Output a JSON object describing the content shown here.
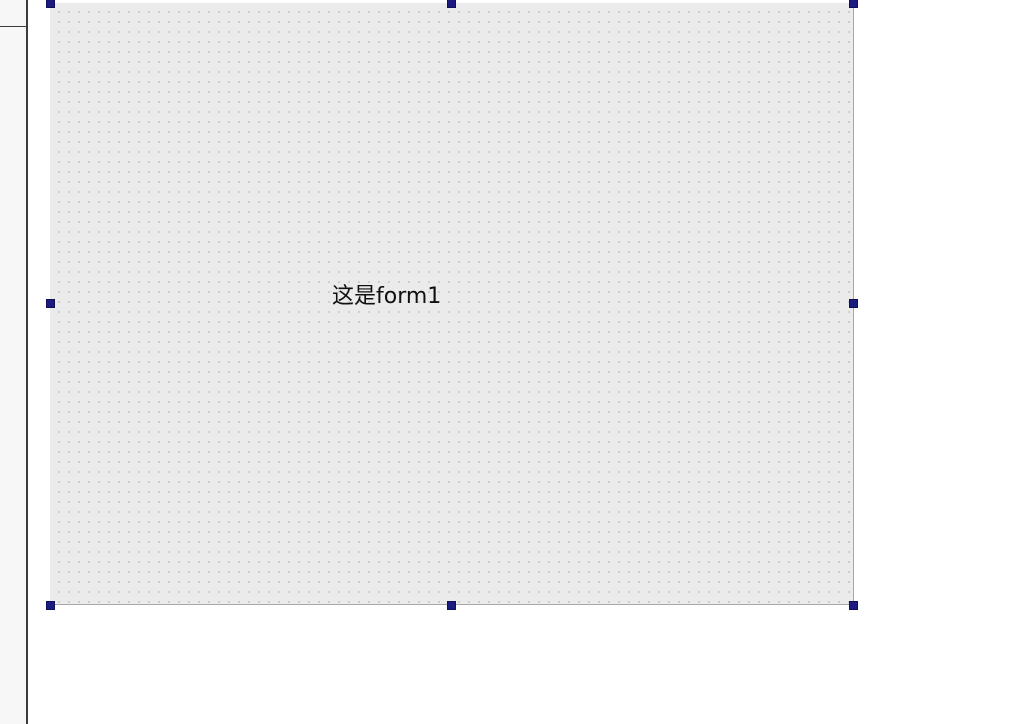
{
  "form": {
    "label_text": "这是form1",
    "selected": true
  },
  "colors": {
    "canvas_background": "#ebebeb",
    "grid_dot": "#b8b8b8",
    "selection_handle": "#1c1c80",
    "page_background": "#ffffff"
  },
  "icons": {
    "selection_handles": "square-handle"
  }
}
